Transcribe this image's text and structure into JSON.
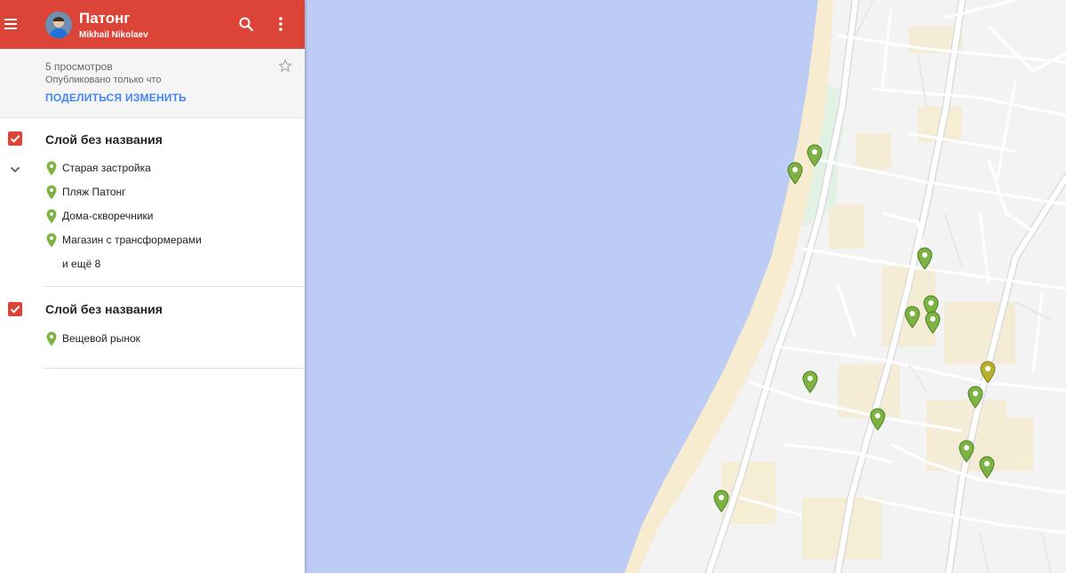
{
  "header": {
    "map_title": "Патонг",
    "owner": "Mikhail Nikolaev"
  },
  "meta": {
    "views": "5 просмотров",
    "published": "Опубликовано только что",
    "share_label": "ПОДЕЛИТЬСЯ",
    "edit_label": "ИЗМЕНИТЬ"
  },
  "layers": [
    {
      "title": "Слой без названия",
      "checked": true,
      "features": [
        "Старая застройка",
        "Пляж Патонг",
        "Дома-скворечники",
        "Магазин с трансформерами"
      ],
      "more": "и ещё 8"
    },
    {
      "title": "Слой без названия",
      "checked": true,
      "features": [
        "Вещевой рынок"
      ]
    }
  ],
  "colors": {
    "header": "#db4437",
    "accent_link": "#4285f4",
    "water": "#bcccf5",
    "land": "#f3f3f3",
    "sand": "#f7ecd0",
    "park": "#e2f3e4",
    "pin_green": "#7cb342",
    "pin_olive": "#b6b12b"
  },
  "icons": {
    "menu": "hamburger-menu-icon",
    "search": "search-icon",
    "more": "more-vert-icon",
    "star": "star-outline-icon",
    "checkbox": "checkbox-checked-icon",
    "collapse": "chevron-down-icon",
    "feature": "map-pin-icon"
  }
}
